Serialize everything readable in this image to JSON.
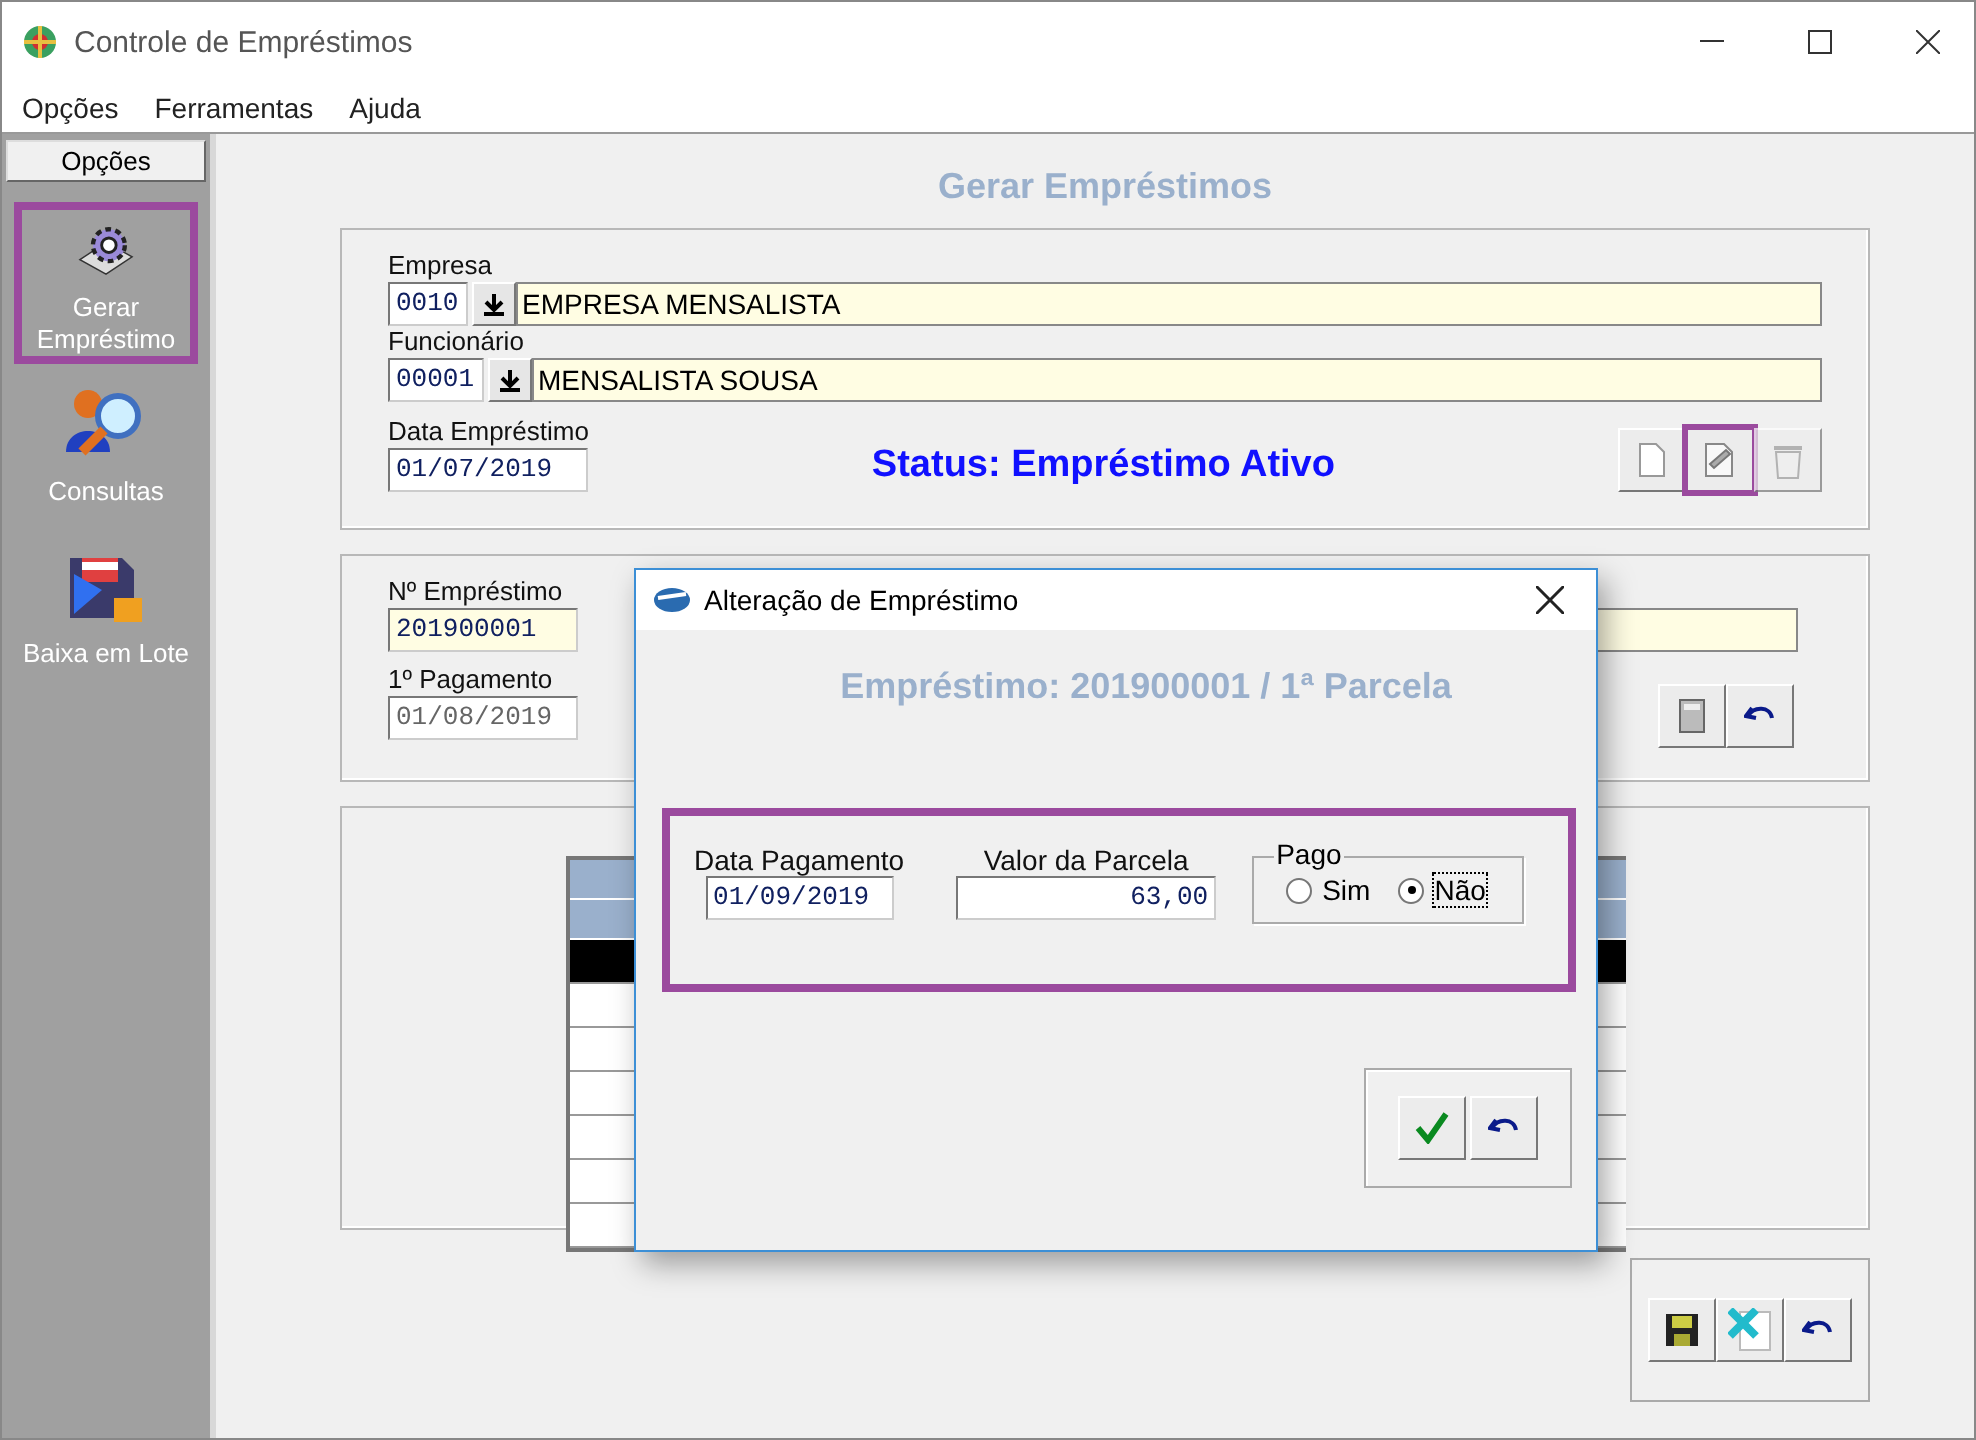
{
  "window": {
    "title": "Controle de Empréstimos"
  },
  "menu": [
    "Opções",
    "Ferramentas",
    "Ajuda"
  ],
  "sidebar": {
    "header": "Opções",
    "items": [
      {
        "label": "Gerar Empréstimo",
        "kind": "gear",
        "highlighted": true
      },
      {
        "label": "Consultas",
        "kind": "search",
        "highlighted": false
      },
      {
        "label": "Baixa em Lote",
        "kind": "disk",
        "highlighted": false
      }
    ]
  },
  "page_title": "Gerar Empréstimos",
  "loan": {
    "empresa_label": "Empresa",
    "empresa_code": "0010",
    "empresa_name": "EMPRESA MENSALISTA",
    "funcionario_label": "Funcionário",
    "funcionario_code": "00001",
    "funcionario_name": "MENSALISTA SOUSA",
    "data_label": "Data Empréstimo",
    "data_value": "01/07/2019",
    "status": "Status: Empréstimo Ativo",
    "actions": [
      {
        "kind": "new",
        "highlighted": false,
        "disabled": false
      },
      {
        "kind": "edit",
        "highlighted": true,
        "disabled": false
      },
      {
        "kind": "delete",
        "highlighted": false,
        "disabled": true
      }
    ]
  },
  "details": {
    "numero_label": "Nº Empréstimo",
    "numero_value": "201900001",
    "pagamento_label": "1º Pagamento",
    "pagamento_value": "01/08/2019"
  },
  "grid": {
    "rows": [
      {
        "selected": true
      },
      {
        "selected": false
      },
      {
        "selected": false
      },
      {
        "selected": false
      },
      {
        "selected": false
      },
      {
        "selected": false
      },
      {
        "selected": false
      }
    ]
  },
  "dialog": {
    "title": "Alteração de Empréstimo",
    "heading": "Empréstimo: 201900001 / 1ª Parcela",
    "data_label": "Data Pagamento",
    "data_value": "01/09/2019",
    "valor_label": "Valor da Parcela",
    "valor_value": "63,00",
    "pago_label": "Pago",
    "options": [
      {
        "label": "Sim",
        "selected": false
      },
      {
        "label": "Não",
        "selected": true
      }
    ],
    "highlighted": true
  }
}
